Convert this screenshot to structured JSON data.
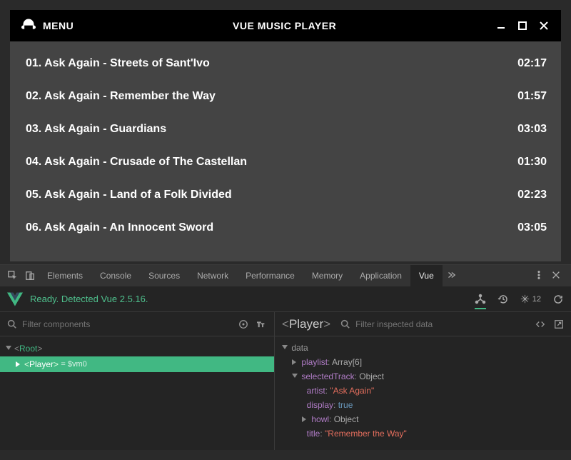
{
  "app": {
    "menu_label": "MENU",
    "title": "VUE MUSIC PLAYER"
  },
  "playlist": [
    {
      "num": "01",
      "artist": "Ask Again",
      "title": "Streets of Sant'Ivo",
      "duration": "02:17"
    },
    {
      "num": "02",
      "artist": "Ask Again",
      "title": "Remember the Way",
      "duration": "01:57"
    },
    {
      "num": "03",
      "artist": "Ask Again",
      "title": "Guardians",
      "duration": "03:03"
    },
    {
      "num": "04",
      "artist": "Ask Again",
      "title": "Crusade of The Castellan",
      "duration": "01:30"
    },
    {
      "num": "05",
      "artist": "Ask Again",
      "title": "Land of a Folk Divided",
      "duration": "02:23"
    },
    {
      "num": "06",
      "artist": "Ask Again",
      "title": "An Innocent Sword",
      "duration": "03:05"
    }
  ],
  "devtools": {
    "tabs": [
      "Elements",
      "Console",
      "Sources",
      "Network",
      "Performance",
      "Memory",
      "Application",
      "Vue"
    ],
    "active_tab": "Vue",
    "status_text": "Ready. Detected Vue 2.5.16.",
    "snowflake_count": "12",
    "left_filter_placeholder": "Filter components",
    "right_filter_placeholder": "Filter inspected data",
    "inspected_component": "Player",
    "tree": {
      "root_label": "Root",
      "child_label": "Player",
      "vm_label": "= $vm0"
    },
    "state": {
      "section": "data",
      "playlist_key": "playlist",
      "playlist_type": "Array[6]",
      "selectedTrack_key": "selectedTrack",
      "selectedTrack_type": "Object",
      "artist_key": "artist",
      "artist_val": "\"Ask Again\"",
      "display_key": "display",
      "display_val": "true",
      "howl_key": "howl",
      "howl_type": "Object",
      "title_key": "title",
      "title_val": "\"Remember the Way\""
    }
  }
}
